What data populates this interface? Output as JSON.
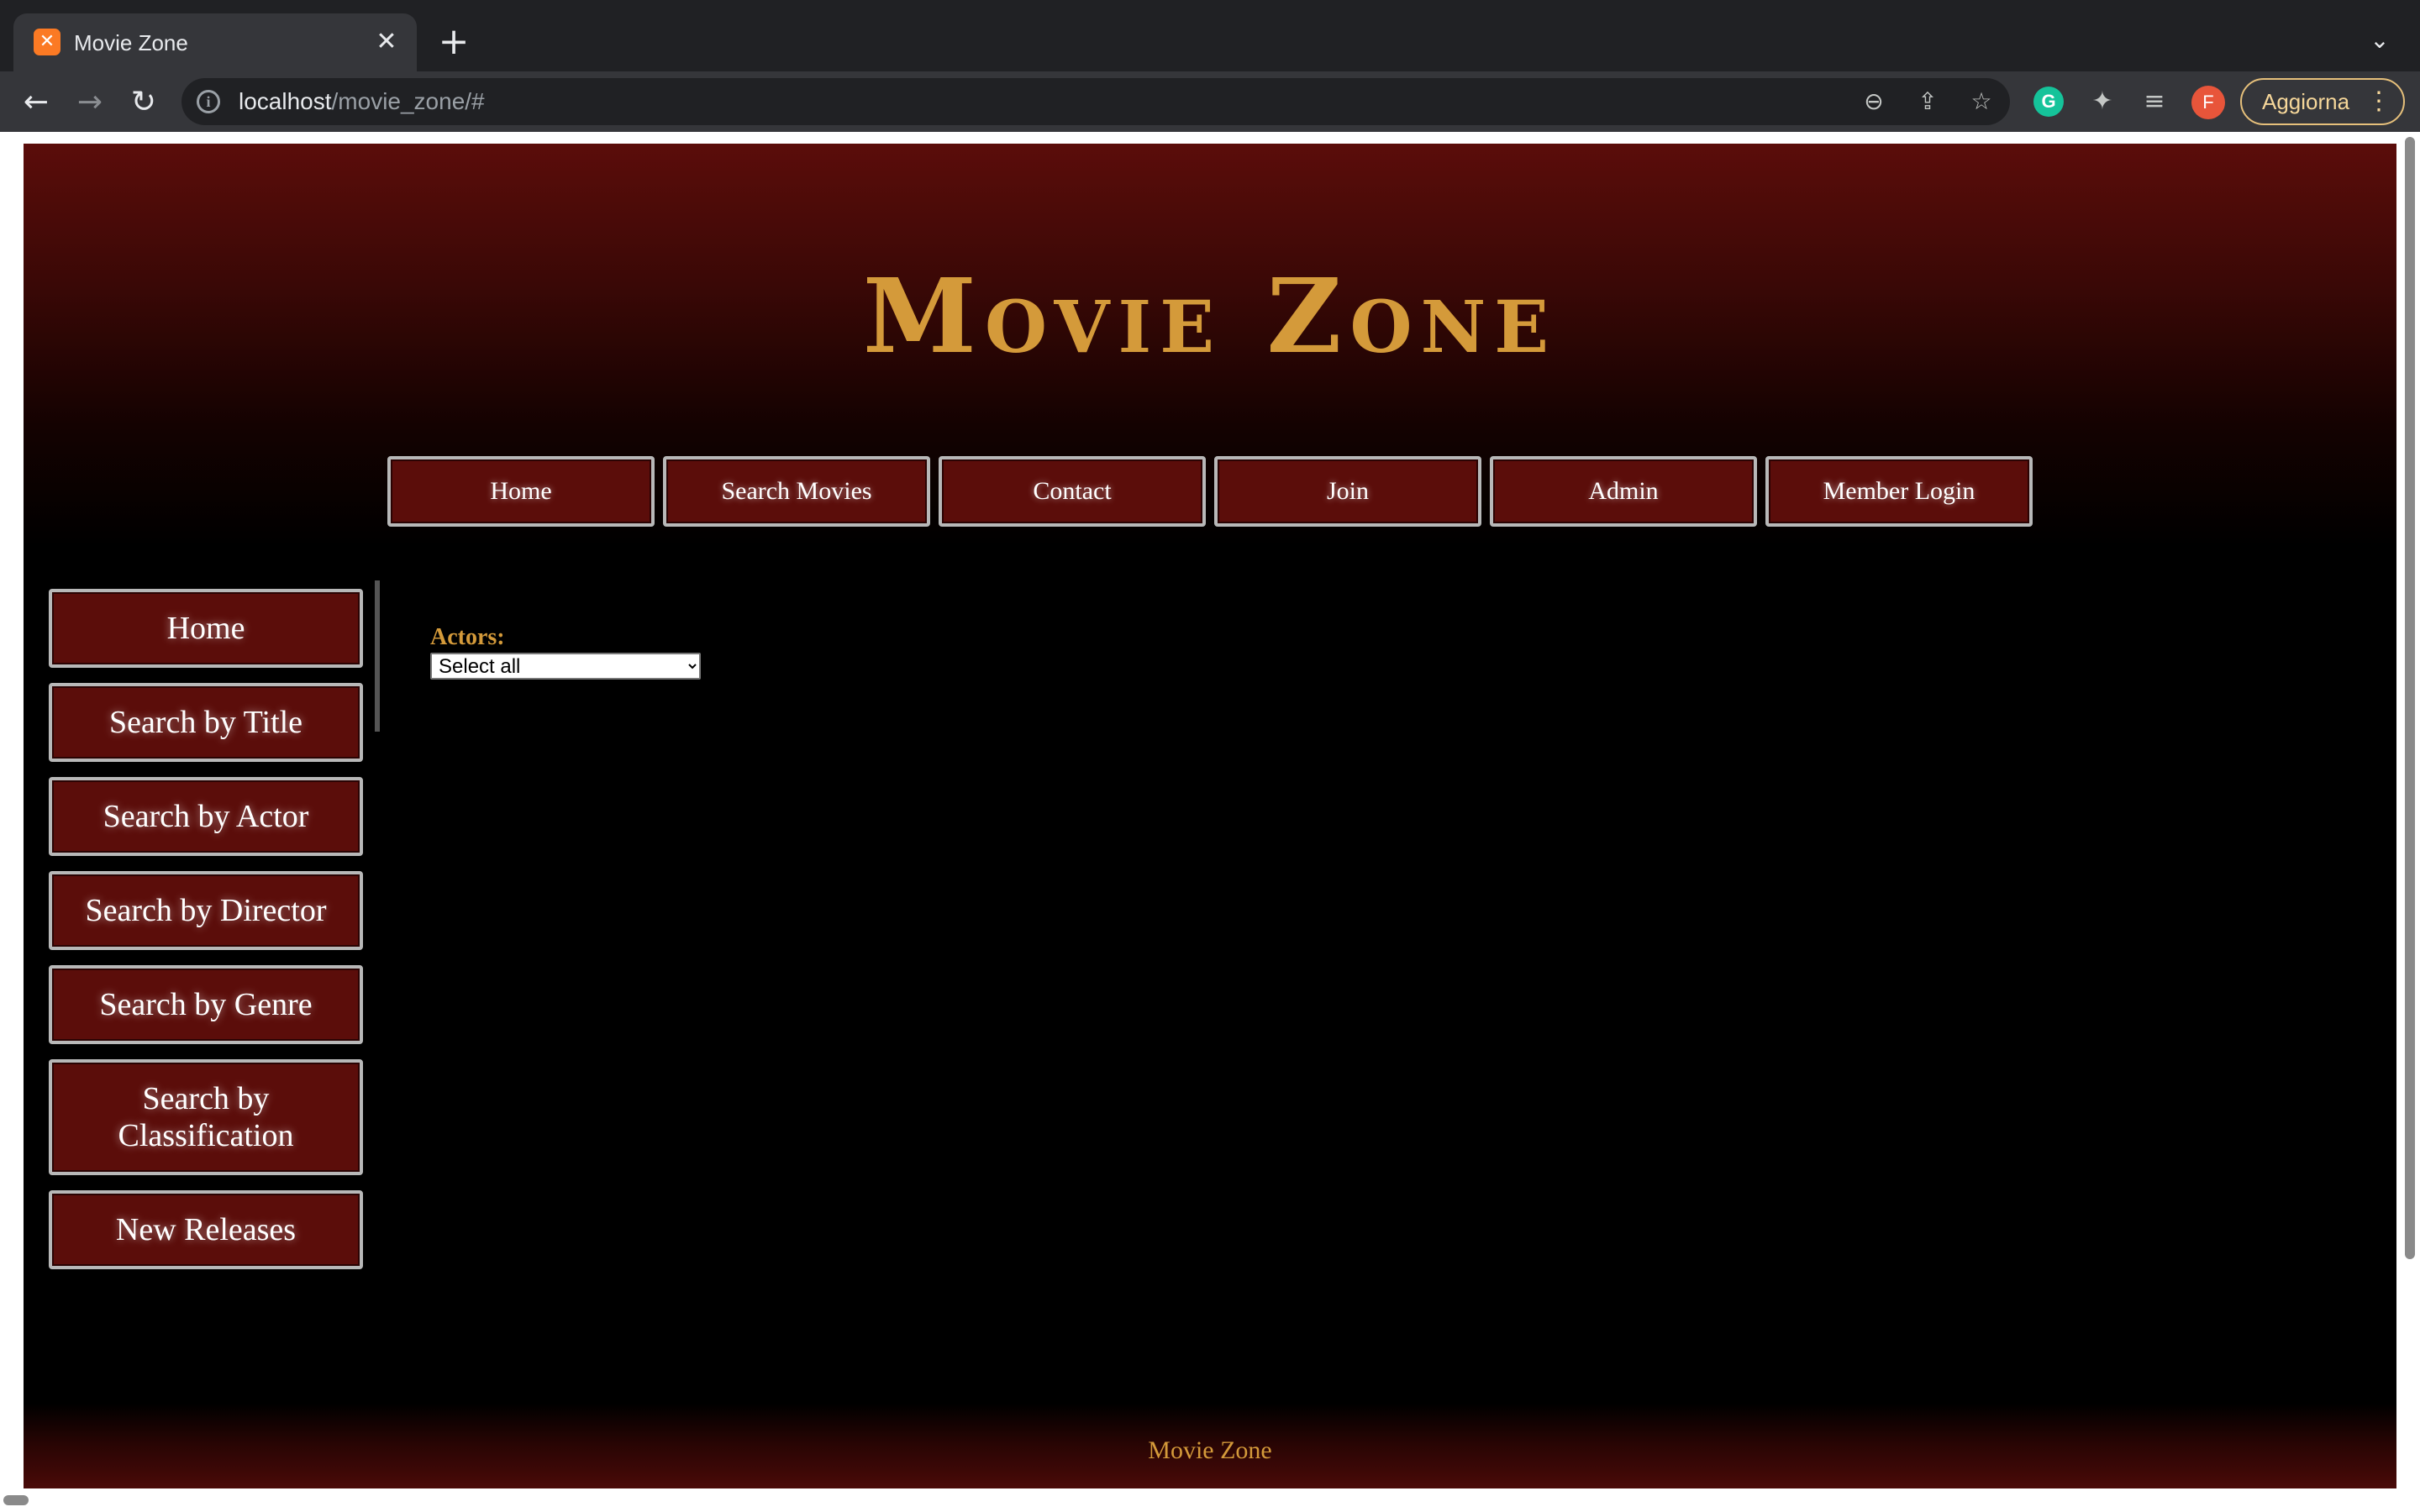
{
  "browser": {
    "tab_title": "Movie Zone",
    "tab_favicon": "xampp-icon",
    "url_host": "localhost",
    "url_path": "/movie_zone/#",
    "update_label": "Aggiorna",
    "profile_initial": "F",
    "grammarly_label": "G"
  },
  "site": {
    "title": "Movie Zone",
    "top_nav": [
      "Home",
      "Search Movies",
      "Contact",
      "Join",
      "Admin",
      "Member Login"
    ],
    "side_nav": [
      "Home",
      "Search by Title",
      "Search by Actor",
      "Search by Director",
      "Search by Genre",
      "Search by Classification",
      "New Releases"
    ],
    "actors_label": "Actors:",
    "actors_selected": "Select all",
    "footer": "Movie Zone"
  },
  "colors": {
    "header_red": "#5b0d0a",
    "gold": "#d49a3a",
    "button_border": "#b8b8b8",
    "chrome_dark": "#202124",
    "chrome_bar": "#35363a"
  }
}
